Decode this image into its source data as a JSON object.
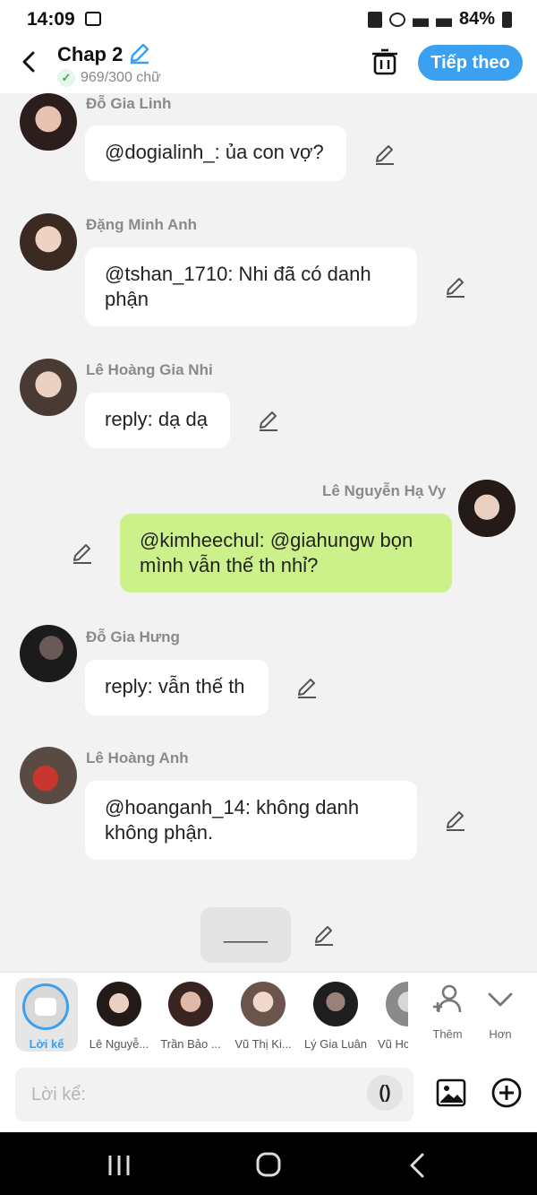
{
  "status_bar": {
    "time": "14:09",
    "battery": "84%"
  },
  "header": {
    "title": "Chap 2",
    "word_count": "969/300 chữ",
    "next_label": "Tiếp theo"
  },
  "messages": [
    {
      "name": "Đỗ Gia Linh",
      "text": "@dogialinh_: ủa con vợ?"
    },
    {
      "name": "Đặng Minh Anh",
      "text": "@tshan_1710: Nhi đã có danh phận"
    },
    {
      "name": "Lê Hoàng Gia Nhi",
      "text": "reply: dạ dạ"
    },
    {
      "name": "Lê Nguyễn Hạ Vy",
      "text": "@kimheechul: @giahungw bọn mình vẫn thế th nhỉ?"
    },
    {
      "name": "Đỗ Gia Hưng",
      "text": "reply: vẫn thế th"
    },
    {
      "name": "Lê Hoàng Anh",
      "text": "@hoanganh_14: không danh không phận."
    }
  ],
  "pending_bubble": "____",
  "characters": {
    "selected": "Lời kể",
    "items": [
      "Lê Nguyễ...",
      "Trần Bảo ...",
      "Vũ Thị Ki...",
      "Lý Gia Luân",
      "Vũ Hc"
    ],
    "add_label": "Thêm",
    "more_label": "Hơn"
  },
  "input": {
    "placeholder": "Lời kể:",
    "paren": "()"
  },
  "colors": {
    "accent": "#3aa0f2",
    "my_bubble": "#ccf08a",
    "name": "#8a8a8a"
  }
}
